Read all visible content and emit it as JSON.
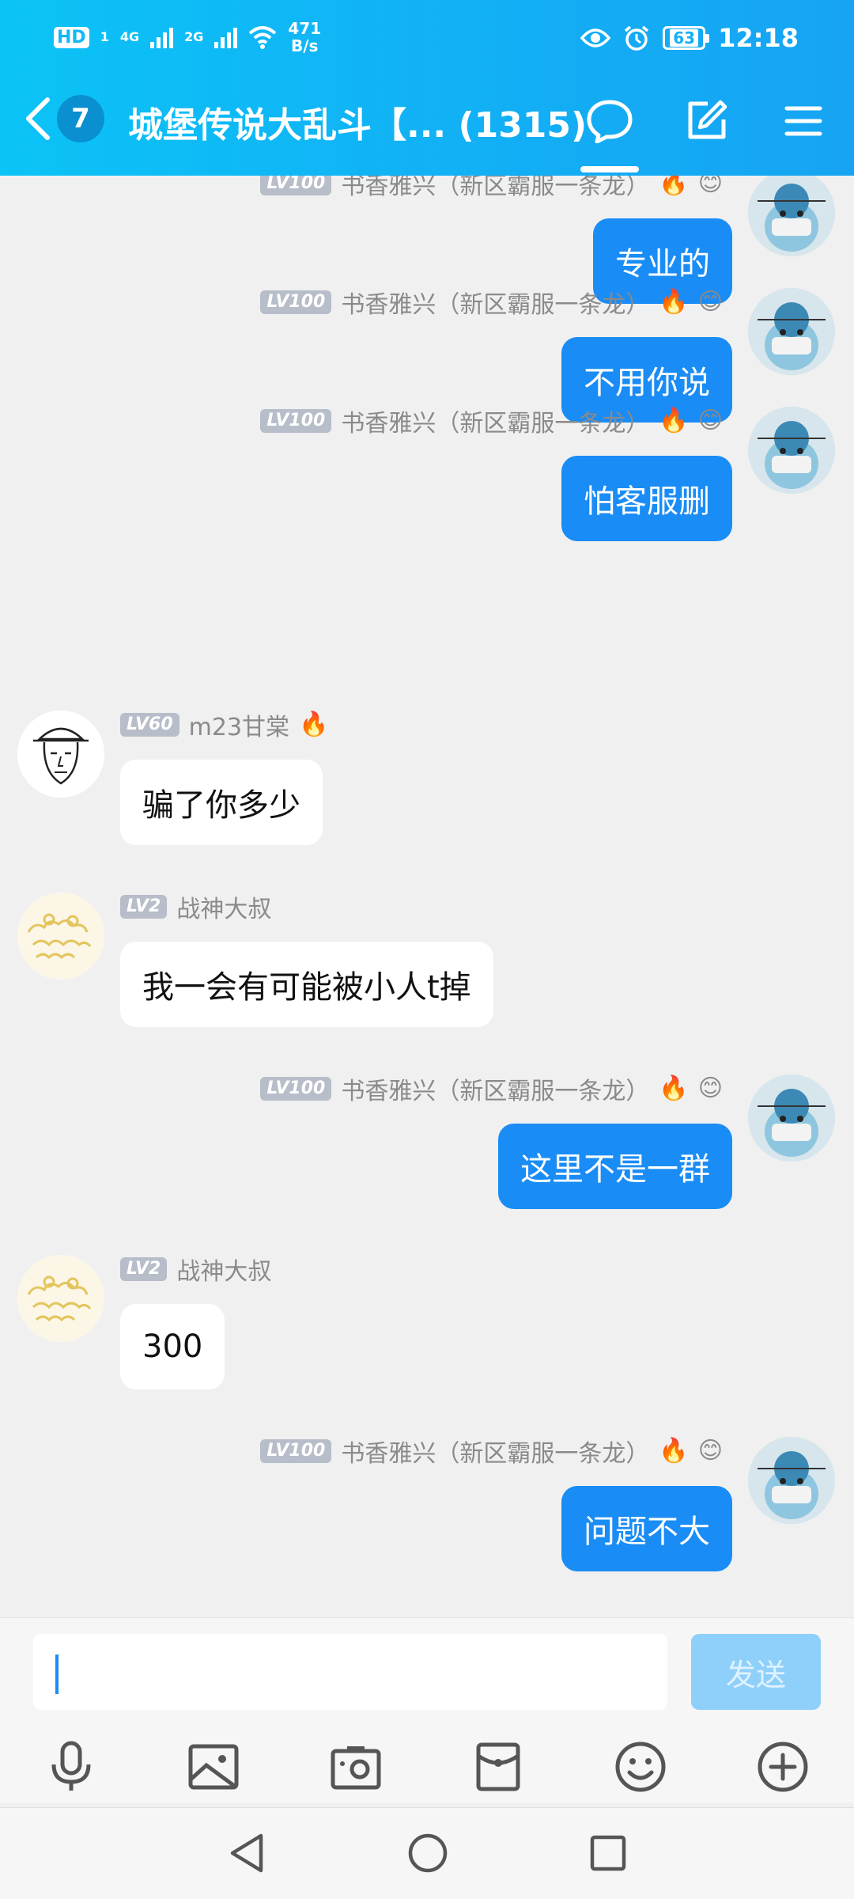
{
  "status_bar": {
    "hd_label": "HD",
    "sim1": "1",
    "net1": "4G",
    "net2": "2G",
    "speed_value": "471",
    "speed_unit": "B/s",
    "battery": "63",
    "time": "12:18"
  },
  "header": {
    "unread_count": "7",
    "group_title": "城堡传说大乱斗【... (1315)"
  },
  "messages": [
    {
      "side": "self",
      "level": "LV100",
      "sender": "书香雅兴（新区霸服一条龙）",
      "text": "专业的"
    },
    {
      "side": "self",
      "level": "LV100",
      "sender": "书香雅兴（新区霸服一条龙）",
      "text": "不用你说"
    },
    {
      "side": "self",
      "level": "LV100",
      "sender": "书香雅兴（新区霸服一条龙）",
      "text": "怕客服删"
    },
    {
      "side": "other",
      "level": "LV60",
      "sender": "m23甘棠",
      "text": "骗了你多少"
    },
    {
      "side": "other",
      "level": "LV2",
      "sender": "战神大叔",
      "text": "我一会有可能被小人t掉"
    },
    {
      "side": "self",
      "level": "LV100",
      "sender": "书香雅兴（新区霸服一条龙）",
      "text": "这里不是一群"
    },
    {
      "side": "other",
      "level": "LV2",
      "sender": "战神大叔",
      "text": "300"
    },
    {
      "side": "self",
      "level": "LV100",
      "sender": "书香雅兴（新区霸服一条龙）",
      "text": "问题不大"
    }
  ],
  "badges": {
    "fire": "🔥",
    "smile": "😊"
  },
  "input": {
    "value": "",
    "send_label": "发送"
  },
  "toolbar": [
    "mic-icon",
    "image-icon",
    "camera-icon",
    "red-packet-icon",
    "emoji-icon",
    "plus-icon"
  ],
  "colors": {
    "header_start": "#0bc3f6",
    "header_end": "#16a4f3",
    "self_bubble": "#1a8cf5",
    "send_disabled": "#8fd0fb"
  }
}
